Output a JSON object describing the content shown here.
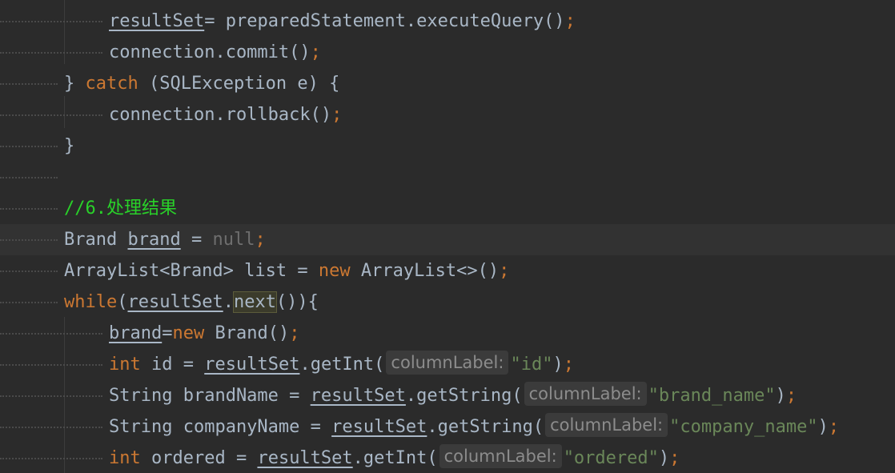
{
  "editor": {
    "lines": [
      {
        "tokens": [
          {
            "t": "resultSet",
            "c": "pl",
            "u": true
          },
          {
            "t": "= preparedStatement.executeQuery()",
            "c": "pl"
          },
          {
            "t": ";",
            "c": "kw"
          }
        ]
      },
      {
        "tokens": [
          {
            "t": "connection.commit()",
            "c": "pl"
          },
          {
            "t": ";",
            "c": "kw"
          }
        ]
      },
      {
        "tokens": [
          {
            "t": "} ",
            "c": "pl"
          },
          {
            "t": "catch",
            "c": "kw"
          },
          {
            "t": " (SQLException e) {",
            "c": "pl"
          }
        ]
      },
      {
        "tokens": [
          {
            "t": "connection.rollback()",
            "c": "pl"
          },
          {
            "t": ";",
            "c": "kw"
          }
        ]
      },
      {
        "tokens": [
          {
            "t": "}",
            "c": "pl"
          }
        ]
      },
      {
        "tokens": []
      },
      {
        "tokens": [
          {
            "t": "//6.处理结果",
            "c": "cmt"
          }
        ]
      },
      {
        "tokens": [
          {
            "t": "Brand ",
            "c": "pl"
          },
          {
            "t": "brand",
            "c": "pl",
            "u": true
          },
          {
            "t": " = ",
            "c": "pl"
          },
          {
            "t": "null",
            "c": "nul"
          },
          {
            "t": ";",
            "c": "kw"
          }
        ]
      },
      {
        "tokens": [
          {
            "t": "ArrayList<Brand> list = ",
            "c": "pl"
          },
          {
            "t": "new",
            "c": "kw"
          },
          {
            "t": " ArrayList<>()",
            "c": "pl"
          },
          {
            "t": ";",
            "c": "kw"
          }
        ]
      },
      {
        "tokens": [
          {
            "t": "while",
            "c": "kw"
          },
          {
            "t": "(",
            "c": "pl"
          },
          {
            "t": "resultSet",
            "c": "pl",
            "u": true
          },
          {
            "t": ".",
            "c": "pl"
          },
          {
            "t": "next",
            "c": "pl",
            "m": true
          },
          {
            "t": "()){",
            "c": "pl"
          }
        ]
      },
      {
        "tokens": [
          {
            "t": "brand",
            "c": "pl",
            "u": true
          },
          {
            "t": "=",
            "c": "pl"
          },
          {
            "t": "new",
            "c": "kw"
          },
          {
            "t": " Brand()",
            "c": "pl"
          },
          {
            "t": ";",
            "c": "kw"
          }
        ]
      },
      {
        "tokens": [
          {
            "t": "int",
            "c": "kw"
          },
          {
            "t": " id = ",
            "c": "pl"
          },
          {
            "t": "resultSet",
            "c": "pl",
            "u": true
          },
          {
            "t": ".getInt(",
            "c": "pl"
          },
          {
            "t": "columnLabel:",
            "c": "hint"
          },
          {
            "t": "\"id\"",
            "c": "str"
          },
          {
            "t": ")",
            "c": "pl"
          },
          {
            "t": ";",
            "c": "kw"
          }
        ]
      },
      {
        "tokens": [
          {
            "t": "String brandName = ",
            "c": "pl"
          },
          {
            "t": "resultSet",
            "c": "pl",
            "u": true
          },
          {
            "t": ".getString(",
            "c": "pl"
          },
          {
            "t": "columnLabel:",
            "c": "hint"
          },
          {
            "t": "\"brand_name\"",
            "c": "str"
          },
          {
            "t": ")",
            "c": "pl"
          },
          {
            "t": ";",
            "c": "kw"
          }
        ]
      },
      {
        "tokens": [
          {
            "t": "String companyName = ",
            "c": "pl"
          },
          {
            "t": "resultSet",
            "c": "pl",
            "u": true
          },
          {
            "t": ".getString(",
            "c": "pl"
          },
          {
            "t": "columnLabel:",
            "c": "hint"
          },
          {
            "t": "\"company_name\"",
            "c": "str"
          },
          {
            "t": ")",
            "c": "pl"
          },
          {
            "t": ";",
            "c": "kw"
          }
        ]
      },
      {
        "tokens": [
          {
            "t": "int",
            "c": "kw"
          },
          {
            "t": " ordered = ",
            "c": "pl"
          },
          {
            "t": "resultSet",
            "c": "pl",
            "u": true
          },
          {
            "t": ".getInt(",
            "c": "pl"
          },
          {
            "t": "columnLabel:",
            "c": "hint"
          },
          {
            "t": "\"ordered\"",
            "c": "str"
          },
          {
            "t": ")",
            "c": "pl"
          },
          {
            "t": ";",
            "c": "kw"
          }
        ]
      }
    ]
  },
  "colors": {
    "background": "#2b2b2b",
    "current_line": "#323232",
    "keyword": "#cc7832",
    "string": "#6a8759",
    "comment": "#29d129",
    "plain": "#a9b7c6",
    "null": "#6e6e6e",
    "hint_bg": "#3b3b3b",
    "hint_fg": "#8c8c8c"
  }
}
